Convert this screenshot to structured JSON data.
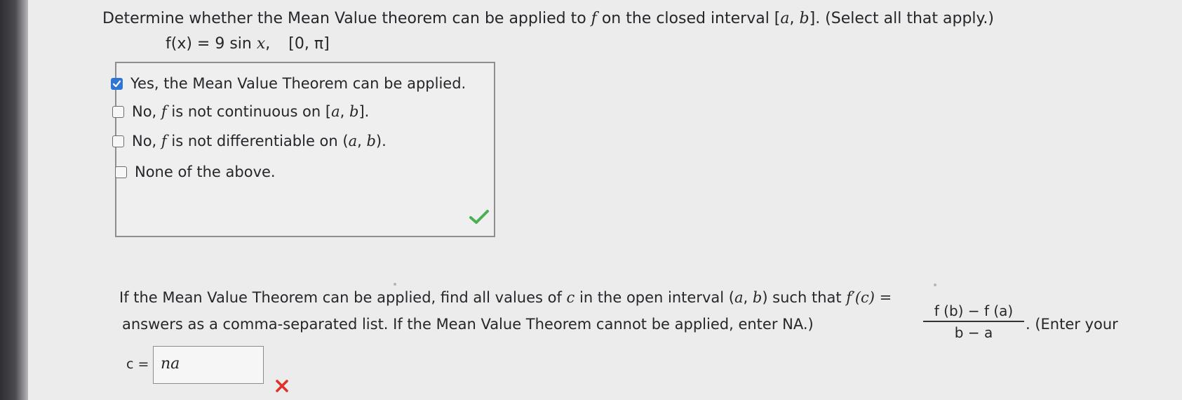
{
  "question1": {
    "prefix": "Determine whether the Mean Value theorem can be applied to ",
    "var": "f",
    "middle": " on the closed interval [",
    "a": "a",
    "comma": ", ",
    "b": "b",
    "suffix": "]. (Select all that apply.)"
  },
  "function_display": {
    "lhs": "f(x) = 9 sin ",
    "var": "x",
    "comma": ",",
    "interval": "[0, π]"
  },
  "choices": [
    {
      "label": "Yes, the Mean Value Theorem can be applied.",
      "checked": true
    },
    {
      "pre": "No, ",
      "f": "f",
      "mid": " is not continuous on [",
      "a": "a",
      "c": ", ",
      "b": "b",
      "end": "].",
      "checked": false
    },
    {
      "pre": "No, ",
      "f": "f",
      "mid": " is not differentiable on (",
      "a": "a",
      "c": ", ",
      "b": "b",
      "end": ").",
      "checked": false
    },
    {
      "label": "None of the above.",
      "checked": false
    }
  ],
  "feedback1": {
    "status": "correct",
    "icon": "checkmark-icon",
    "color": "#4caf50"
  },
  "question2": {
    "l1a": "If the Mean Value Theorem can be applied, find all values of ",
    "c": "c",
    "l1b": " in the open interval (",
    "a": "a",
    "comma": ", ",
    "b": "b",
    "l1c": ") such that ",
    "fprime": "f′(c) =",
    "frac_num": "f (b) − f (a)",
    "frac_den": "b − a",
    "tail": ". (Enter your",
    "line2": "answers as a comma-separated list. If the Mean Value Theorem cannot be applied, enter NA.)"
  },
  "answer": {
    "label": "c =",
    "value": "na"
  },
  "feedback2": {
    "status": "incorrect",
    "icon": "x-icon",
    "color": "#e0302a"
  }
}
